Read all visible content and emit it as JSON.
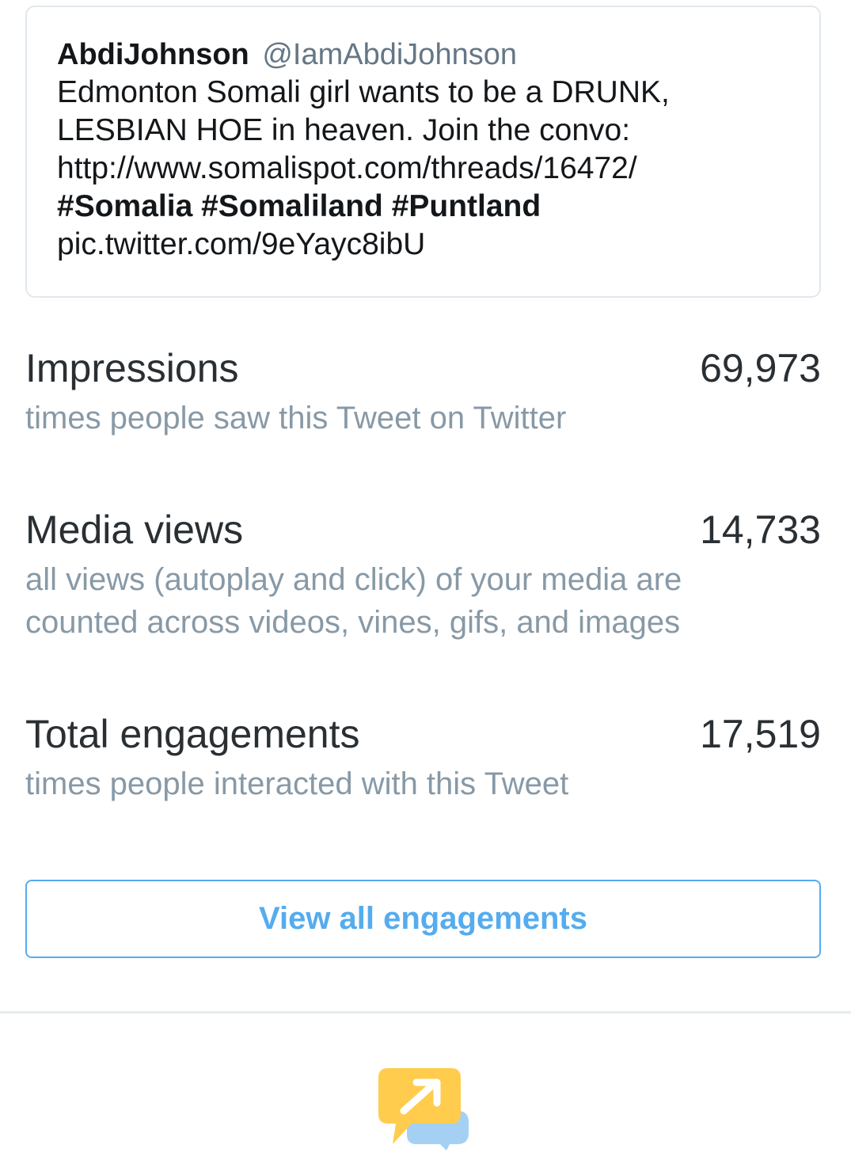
{
  "tweet": {
    "author_name": "AbdiJohnson",
    "author_handle": "@IamAbdiJohnson",
    "text_line1": "Edmonton Somali girl wants to be a DRUNK,",
    "text_line2": "LESBIAN HOE in heaven. Join the convo:",
    "link": "http://www.somalispot.com/threads/16472/",
    "hashtags": [
      "#Somalia",
      "#Somaliland",
      "#Puntland"
    ],
    "pic_link": "pic.twitter.com/9eYayc8ibU"
  },
  "metrics": [
    {
      "title": "Impressions",
      "value": "69,973",
      "description": "times people saw this Tweet on Twitter"
    },
    {
      "title": "Media views",
      "value": "14,733",
      "description": "all views (autoplay and click) of your media are counted across videos, vines, gifs, and images"
    },
    {
      "title": "Total engagements",
      "value": "17,519",
      "description": "times people interacted with this Tweet"
    }
  ],
  "view_all_button": "View all engagements",
  "icons": {
    "promote": "promote-speech-bubble-icon"
  },
  "colors": {
    "accent": "#55acee",
    "secondary_text": "#8899a6",
    "handle_text": "#657786",
    "icon_yellow": "#ffcc4d",
    "icon_blue": "#a4d0f3"
  }
}
